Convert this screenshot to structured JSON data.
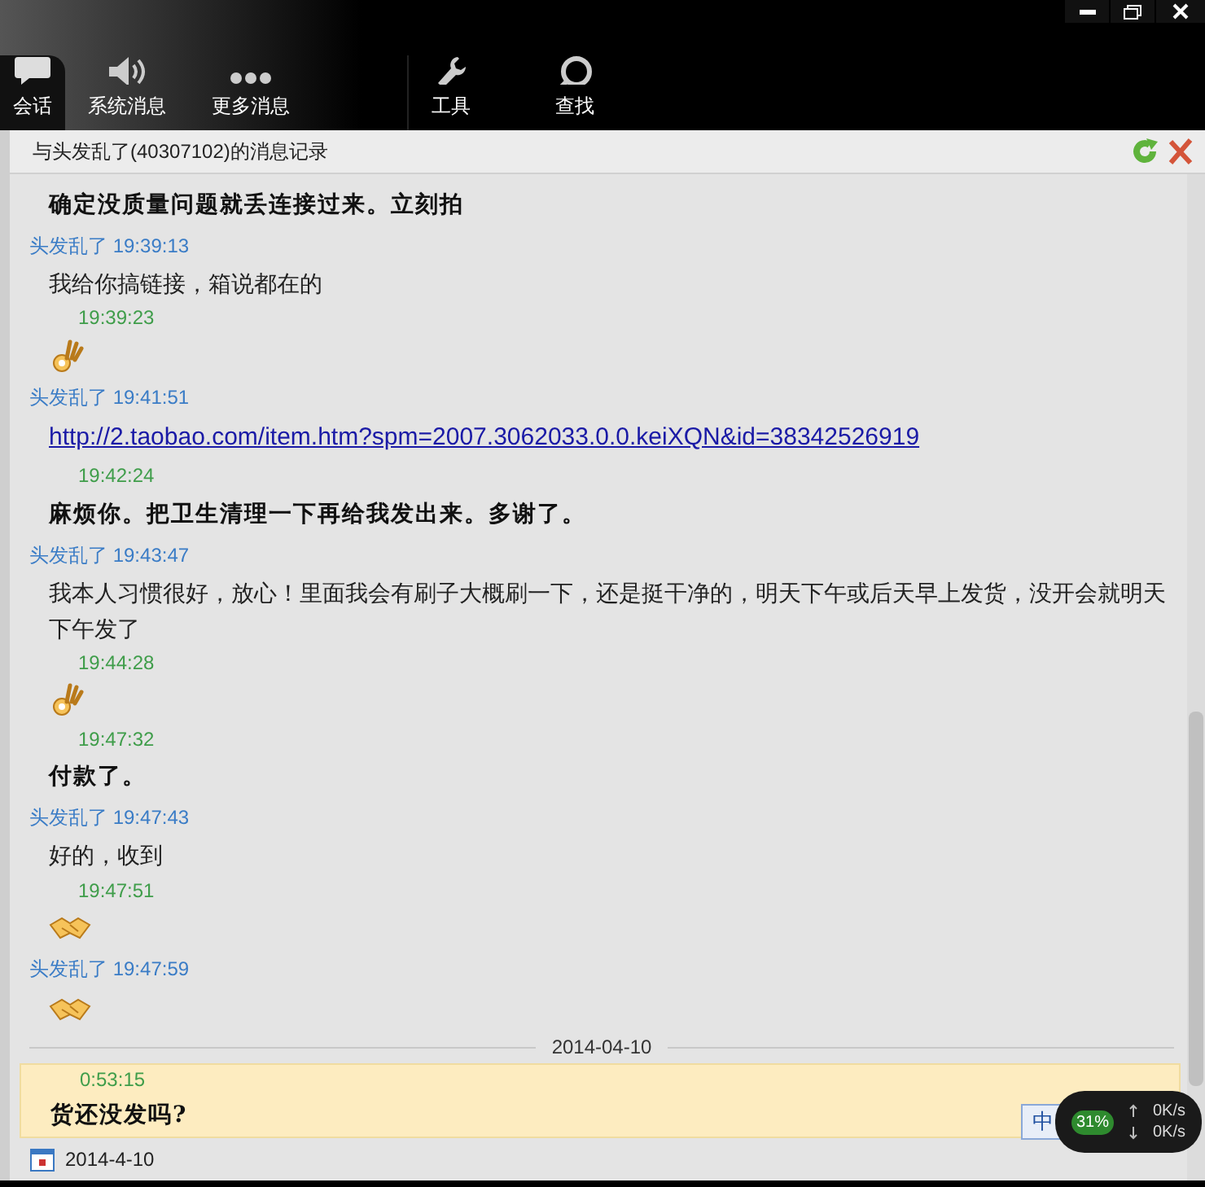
{
  "toolbar": [
    {
      "label": "会话",
      "selected": true,
      "kind": "chat"
    },
    {
      "label": "系统消息",
      "selected": false,
      "kind": "speaker"
    },
    {
      "label": "更多消息",
      "selected": false,
      "kind": "dots"
    },
    {
      "label": "工具",
      "selected": false,
      "kind": "wrench"
    },
    {
      "label": "查找",
      "selected": false,
      "kind": "search"
    }
  ],
  "history_title": "与头发乱了(40307102)的消息记录",
  "messages": [
    {
      "kind": "text",
      "text": "确定没质量问题就丢连接过来。立刻拍",
      "bold": true
    },
    {
      "kind": "meta",
      "sender": "头发乱了",
      "time": "19:39:13"
    },
    {
      "kind": "text",
      "text": "我给你搞链接，箱说都在的",
      "bold": false
    },
    {
      "kind": "meta",
      "time": "19:39:23"
    },
    {
      "kind": "okhand"
    },
    {
      "kind": "meta",
      "sender": "头发乱了",
      "time": "19:41:51"
    },
    {
      "kind": "link",
      "text": "http://2.taobao.com/item.htm?spm=2007.3062033.0.0.keiXQN&id=38342526919"
    },
    {
      "kind": "meta",
      "time": "19:42:24"
    },
    {
      "kind": "text",
      "text": "麻烦你。把卫生清理一下再给我发出来。多谢了。",
      "bold": true
    },
    {
      "kind": "meta",
      "sender": "头发乱了",
      "time": "19:43:47"
    },
    {
      "kind": "text",
      "text": "我本人习惯很好，放心！里面我会有刷子大概刷一下，还是挺干净的，明天下午或后天早上发货，没开会就明天下午发了",
      "bold": false
    },
    {
      "kind": "meta",
      "time": "19:44:28"
    },
    {
      "kind": "okhand"
    },
    {
      "kind": "meta",
      "time": "19:47:32"
    },
    {
      "kind": "text",
      "text": "付款了。",
      "bold": true
    },
    {
      "kind": "meta",
      "sender": "头发乱了",
      "time": "19:47:43"
    },
    {
      "kind": "text",
      "text": "好的，收到",
      "bold": false
    },
    {
      "kind": "meta",
      "time": "19:47:51"
    },
    {
      "kind": "handshake"
    },
    {
      "kind": "meta",
      "sender": "头发乱了",
      "time": "19:47:59"
    },
    {
      "kind": "handshake"
    }
  ],
  "date_divider": "2014-04-10",
  "highlighted": [
    {
      "kind": "meta",
      "time": "0:53:15"
    },
    {
      "kind": "text",
      "text": "货还没发吗?",
      "bold": true
    }
  ],
  "footer_date": "2014-4-10",
  "ime": "中",
  "net_monitor": {
    "percent": "31%",
    "up": "0K/s",
    "down": "0K/s"
  }
}
